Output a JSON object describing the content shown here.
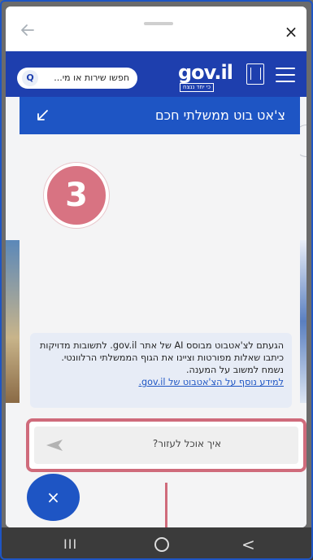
{
  "sheet": {
    "back_icon": "arrow-left-icon",
    "close_icon": "close-icon",
    "close_glyph": "×"
  },
  "header": {
    "logo_text": "gov.il",
    "logo_tagline": "כי יחד ננצח",
    "search_placeholder": "חפשו שירות או מי...",
    "search_icon": "search-icon",
    "search_button_glyph": "Q",
    "menu_icon": "hamburger-icon",
    "brand_color": "#1e3fae"
  },
  "chat": {
    "title": "צ'אט בוט ממשלתי חכם",
    "minimize_icon": "minimize-arrow-icon",
    "header_color": "#1e55c4",
    "step_number": "3",
    "notice_text": "הגעתם לצ'אטבוט מבוסס AI של אתר gov.il. לתשובות מדויקות כיתבו שאלות מפורטות וציינו את הגוף הממשלתי הרלוונטי. נשמח למשוב על המענה.",
    "notice_link": "למידע נוסף על הצ'אטבוט של gov.il.",
    "input_placeholder": "איך אוכל לעזור?",
    "send_icon": "send-icon",
    "highlight_color": "#cf6b7b",
    "close_fab_glyph": "×"
  },
  "nav": {
    "recents_glyph": "III",
    "home_icon": "home-circle-icon",
    "back_glyph": "<"
  }
}
